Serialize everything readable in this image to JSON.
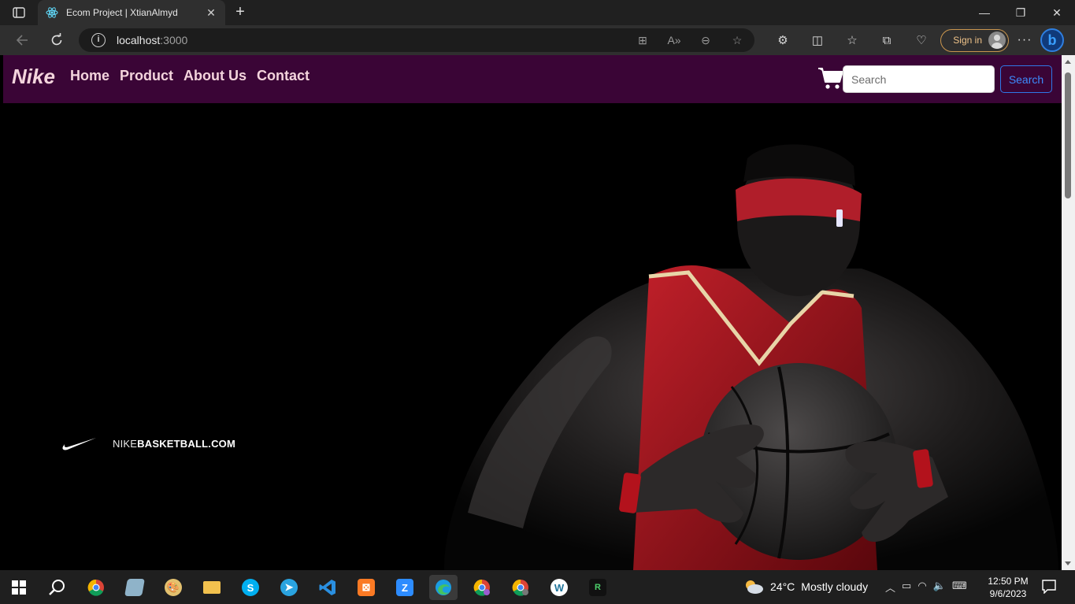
{
  "browser": {
    "tab_title": "Ecom Project | XtianAlmyd",
    "url_host": "localhost",
    "url_port": ":3000",
    "signin_label": "Sign in"
  },
  "page": {
    "brand": "Nike",
    "nav_links": [
      "Home",
      "Product",
      "About Us",
      "Contact"
    ],
    "search_placeholder": "Search",
    "search_button": "Search",
    "hero_url_prefix": "NIKE",
    "hero_url_main": "BASKETBALL.COM"
  },
  "taskbar": {
    "temperature": "24°C",
    "condition": "Mostly cloudy",
    "time": "12:50 PM",
    "date": "9/6/2023"
  },
  "colors": {
    "navbar": "#3a0536",
    "nav_text": "#f3d4dc",
    "search_button": "#3d8bfd",
    "jersey_red": "#a8121c"
  }
}
